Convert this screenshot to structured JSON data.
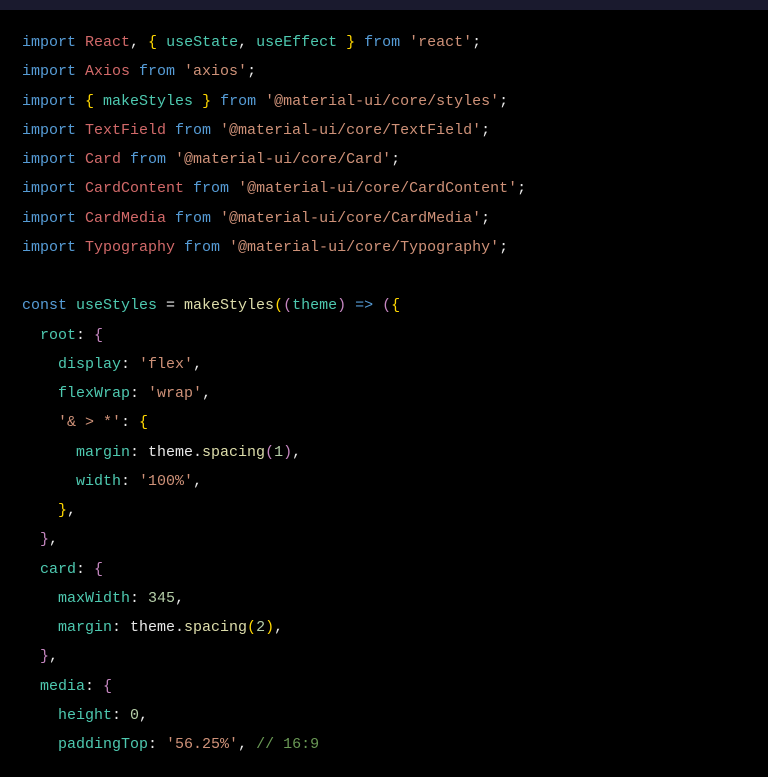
{
  "lines": [
    [
      {
        "t": "import ",
        "c": "kw-import"
      },
      {
        "t": "React",
        "c": "ident-red"
      },
      {
        "t": ", ",
        "c": "punct"
      },
      {
        "t": "{",
        "c": "brace-yellow"
      },
      {
        "t": " useState",
        "c": "ident-teal"
      },
      {
        "t": ", ",
        "c": "punct"
      },
      {
        "t": "useEffect ",
        "c": "ident-teal"
      },
      {
        "t": "}",
        "c": "brace-yellow"
      },
      {
        "t": " from ",
        "c": "kw-from"
      },
      {
        "t": "'react'",
        "c": "string"
      },
      {
        "t": ";",
        "c": "punct"
      }
    ],
    [
      {
        "t": "import ",
        "c": "kw-import"
      },
      {
        "t": "Axios",
        "c": "ident-red"
      },
      {
        "t": " from ",
        "c": "kw-from"
      },
      {
        "t": "'axios'",
        "c": "string"
      },
      {
        "t": ";",
        "c": "punct"
      }
    ],
    [
      {
        "t": "import ",
        "c": "kw-import"
      },
      {
        "t": "{",
        "c": "brace-yellow"
      },
      {
        "t": " makeStyles ",
        "c": "ident-teal"
      },
      {
        "t": "}",
        "c": "brace-yellow"
      },
      {
        "t": " from ",
        "c": "kw-from"
      },
      {
        "t": "'@material-ui/core/styles'",
        "c": "string"
      },
      {
        "t": ";",
        "c": "punct"
      }
    ],
    [
      {
        "t": "import ",
        "c": "kw-import"
      },
      {
        "t": "TextField",
        "c": "ident-red"
      },
      {
        "t": " from ",
        "c": "kw-from"
      },
      {
        "t": "'@material-ui/core/TextField'",
        "c": "string"
      },
      {
        "t": ";",
        "c": "punct"
      }
    ],
    [
      {
        "t": "import ",
        "c": "kw-import"
      },
      {
        "t": "Card",
        "c": "ident-red"
      },
      {
        "t": " from ",
        "c": "kw-from"
      },
      {
        "t": "'@material-ui/core/Card'",
        "c": "string"
      },
      {
        "t": ";",
        "c": "punct"
      }
    ],
    [
      {
        "t": "import ",
        "c": "kw-import"
      },
      {
        "t": "CardContent",
        "c": "ident-red"
      },
      {
        "t": " from ",
        "c": "kw-from"
      },
      {
        "t": "'@material-ui/core/CardContent'",
        "c": "string"
      },
      {
        "t": ";",
        "c": "punct"
      }
    ],
    [
      {
        "t": "import ",
        "c": "kw-import"
      },
      {
        "t": "CardMedia",
        "c": "ident-red"
      },
      {
        "t": " from ",
        "c": "kw-from"
      },
      {
        "t": "'@material-ui/core/CardMedia'",
        "c": "string"
      },
      {
        "t": ";",
        "c": "punct"
      }
    ],
    [
      {
        "t": "import ",
        "c": "kw-import"
      },
      {
        "t": "Typography",
        "c": "ident-red"
      },
      {
        "t": " from ",
        "c": "kw-from"
      },
      {
        "t": "'@material-ui/core/Typography'",
        "c": "string"
      },
      {
        "t": ";",
        "c": "punct"
      }
    ],
    [
      {
        "t": "",
        "c": "plain"
      }
    ],
    [
      {
        "t": "const ",
        "c": "kw-const"
      },
      {
        "t": "useStyles",
        "c": "ident-teal"
      },
      {
        "t": " = ",
        "c": "punct"
      },
      {
        "t": "makeStyles",
        "c": "func-yellow"
      },
      {
        "t": "(",
        "c": "brace-yellow"
      },
      {
        "t": "(",
        "c": "brace-purple"
      },
      {
        "t": "theme",
        "c": "ident-teal"
      },
      {
        "t": ")",
        "c": "brace-purple"
      },
      {
        "t": " => ",
        "c": "arrow"
      },
      {
        "t": "(",
        "c": "brace-purple"
      },
      {
        "t": "{",
        "c": "brace-yellow"
      }
    ],
    [
      {
        "t": "  root",
        "c": "ident-teal"
      },
      {
        "t": ": ",
        "c": "punct"
      },
      {
        "t": "{",
        "c": "brace-purple"
      }
    ],
    [
      {
        "t": "    display",
        "c": "ident-teal"
      },
      {
        "t": ": ",
        "c": "punct"
      },
      {
        "t": "'flex'",
        "c": "string"
      },
      {
        "t": ",",
        "c": "punct"
      }
    ],
    [
      {
        "t": "    flexWrap",
        "c": "ident-teal"
      },
      {
        "t": ": ",
        "c": "punct"
      },
      {
        "t": "'wrap'",
        "c": "string"
      },
      {
        "t": ",",
        "c": "punct"
      }
    ],
    [
      {
        "t": "    '& > *'",
        "c": "string"
      },
      {
        "t": ": ",
        "c": "punct"
      },
      {
        "t": "{",
        "c": "brace-yellow"
      }
    ],
    [
      {
        "t": "      margin",
        "c": "ident-teal"
      },
      {
        "t": ": theme.",
        "c": "punct"
      },
      {
        "t": "spacing",
        "c": "func-yellow"
      },
      {
        "t": "(",
        "c": "brace-purple"
      },
      {
        "t": "1",
        "c": "number"
      },
      {
        "t": ")",
        "c": "brace-purple"
      },
      {
        "t": ",",
        "c": "punct"
      }
    ],
    [
      {
        "t": "      width",
        "c": "ident-teal"
      },
      {
        "t": ": ",
        "c": "punct"
      },
      {
        "t": "'100%'",
        "c": "string"
      },
      {
        "t": ",",
        "c": "punct"
      }
    ],
    [
      {
        "t": "    ",
        "c": "plain"
      },
      {
        "t": "}",
        "c": "brace-yellow"
      },
      {
        "t": ",",
        "c": "punct"
      }
    ],
    [
      {
        "t": "  ",
        "c": "plain"
      },
      {
        "t": "}",
        "c": "brace-purple"
      },
      {
        "t": ",",
        "c": "punct"
      }
    ],
    [
      {
        "t": "  card",
        "c": "ident-teal"
      },
      {
        "t": ": ",
        "c": "punct"
      },
      {
        "t": "{",
        "c": "brace-purple"
      }
    ],
    [
      {
        "t": "    maxWidth",
        "c": "ident-teal"
      },
      {
        "t": ": ",
        "c": "punct"
      },
      {
        "t": "345",
        "c": "number"
      },
      {
        "t": ",",
        "c": "punct"
      }
    ],
    [
      {
        "t": "    margin",
        "c": "ident-teal"
      },
      {
        "t": ": theme.",
        "c": "punct"
      },
      {
        "t": "spacing",
        "c": "func-yellow"
      },
      {
        "t": "(",
        "c": "brace-yellow"
      },
      {
        "t": "2",
        "c": "number"
      },
      {
        "t": ")",
        "c": "brace-yellow"
      },
      {
        "t": ",",
        "c": "punct"
      }
    ],
    [
      {
        "t": "  ",
        "c": "plain"
      },
      {
        "t": "}",
        "c": "brace-purple"
      },
      {
        "t": ",",
        "c": "punct"
      }
    ],
    [
      {
        "t": "  media",
        "c": "ident-teal"
      },
      {
        "t": ": ",
        "c": "punct"
      },
      {
        "t": "{",
        "c": "brace-purple"
      }
    ],
    [
      {
        "t": "    height",
        "c": "ident-teal"
      },
      {
        "t": ": ",
        "c": "punct"
      },
      {
        "t": "0",
        "c": "number"
      },
      {
        "t": ",",
        "c": "punct"
      }
    ],
    [
      {
        "t": "    paddingTop",
        "c": "ident-teal"
      },
      {
        "t": ": ",
        "c": "punct"
      },
      {
        "t": "'56.25%'",
        "c": "string"
      },
      {
        "t": ", ",
        "c": "punct"
      },
      {
        "t": "// 16:9",
        "c": "comment"
      }
    ]
  ]
}
